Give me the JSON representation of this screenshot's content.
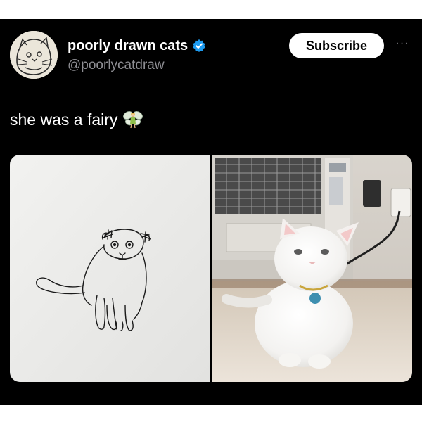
{
  "post": {
    "author": {
      "display_name": "poorly drawn cats",
      "handle": "@poorlycatdraw",
      "verified": true,
      "avatar_icon": "cat-drawing-avatar"
    },
    "subscribe_label": "Subscribe",
    "more_label": "···",
    "text": "she was a fairy",
    "emoji_icon": "fairy-emoji",
    "media": [
      {
        "name": "cat-drawing-image",
        "kind": "line drawing on paper"
      },
      {
        "name": "cat-photo-image",
        "kind": "photo"
      }
    ]
  },
  "colors": {
    "background": "#000000",
    "text": "#ffffff",
    "handle": "#8e8e93",
    "verified": "#1d9bf0",
    "button_bg": "#ffffff"
  }
}
